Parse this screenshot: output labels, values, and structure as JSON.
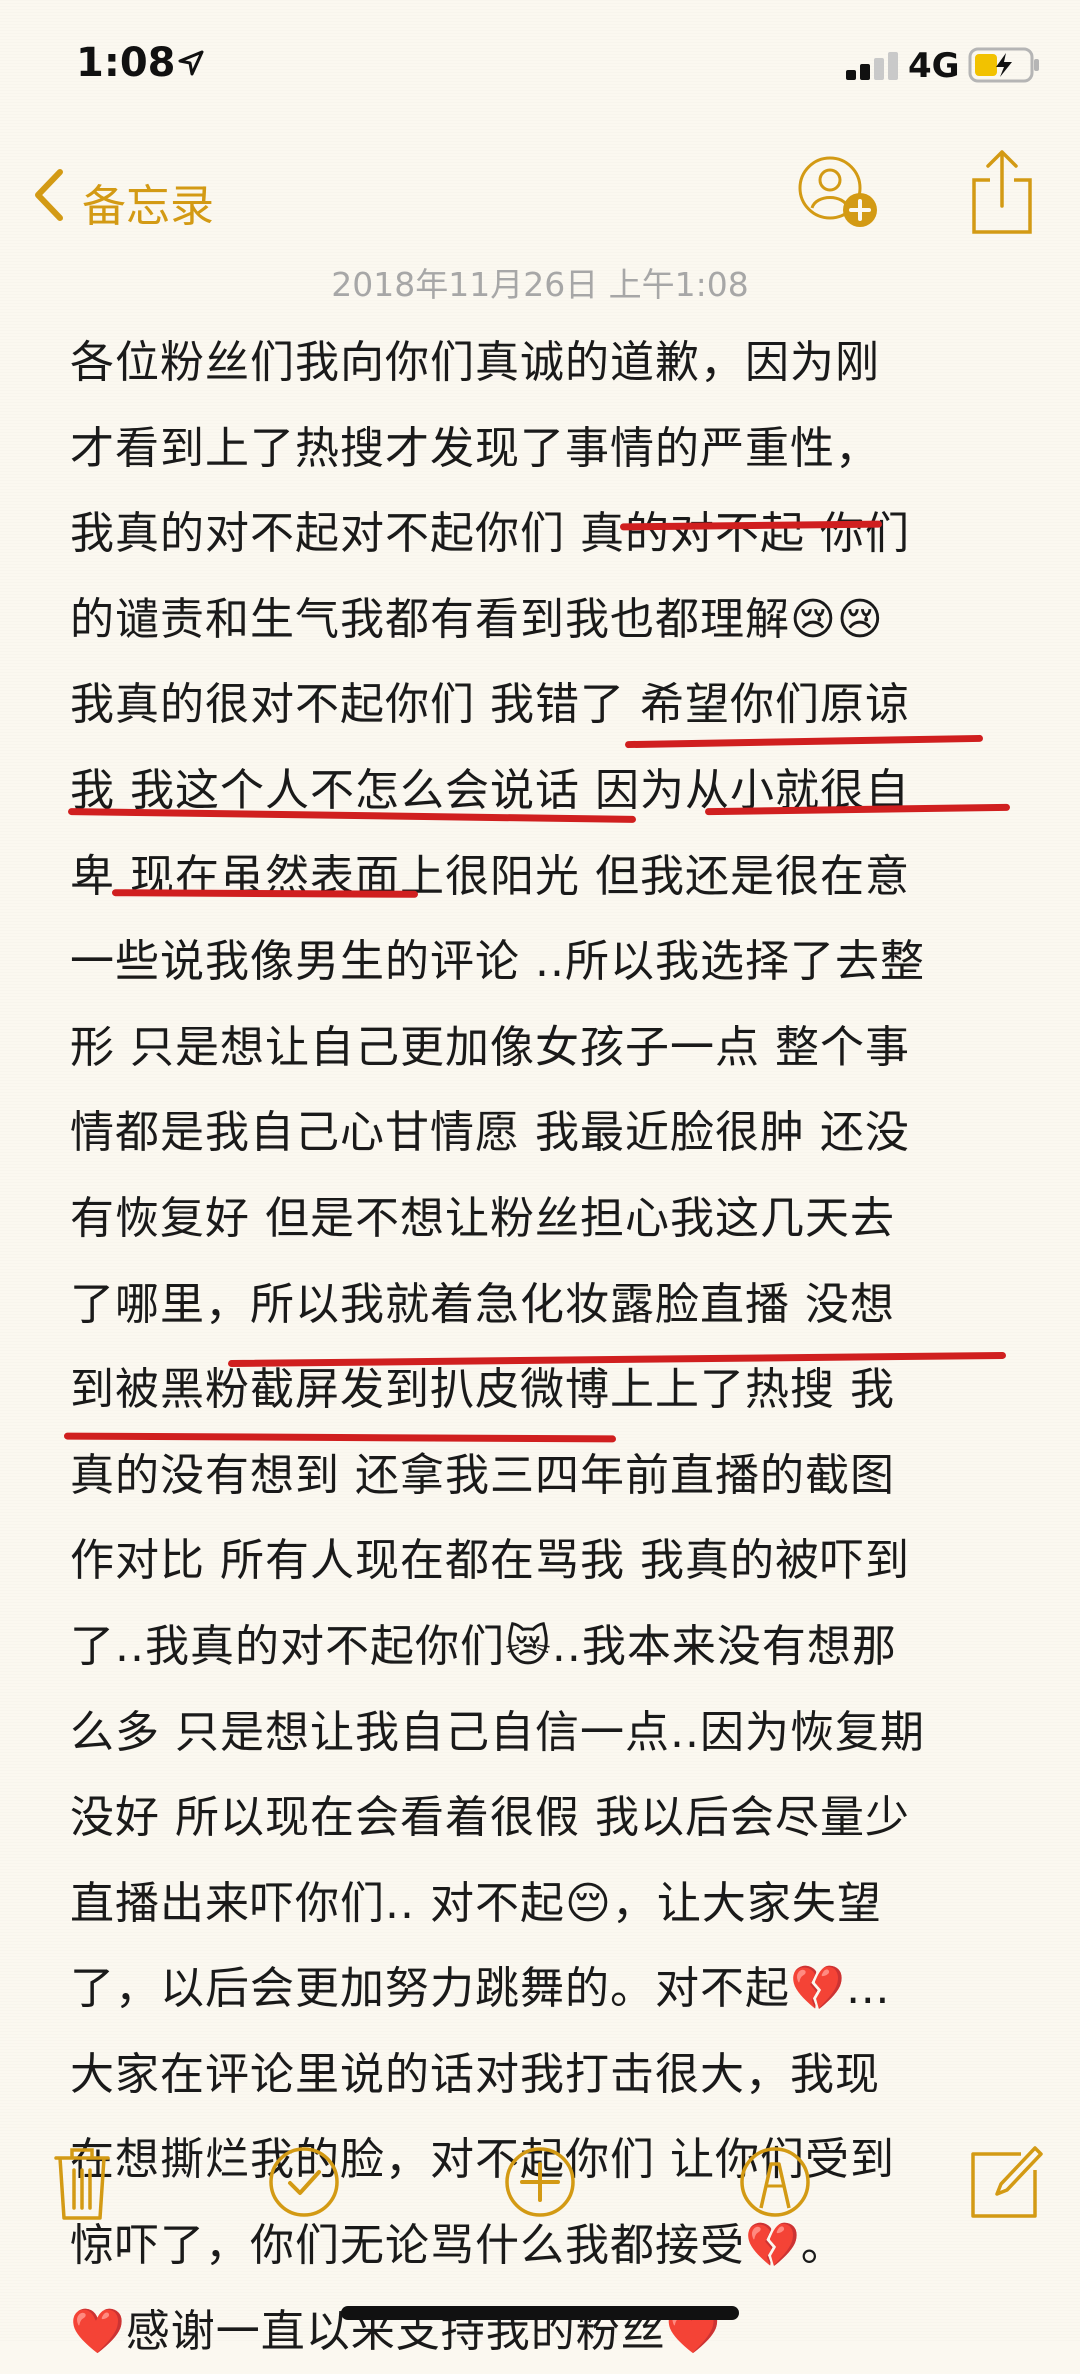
{
  "status_bar": {
    "time": "1:08",
    "network": "4G"
  },
  "nav": {
    "back_label": "备忘录"
  },
  "note": {
    "date": "2018年11月26日 上午1:08",
    "lines": [
      "各位粉丝们我向你们真诚的道歉，因为刚",
      "才看到上了热搜才发现了事情的严重性，",
      "我真的对不起对不起你们 真的对不起 你们",
      "的谴责和生气我都有看到我也都理解😢😢",
      "我真的很对不起你们 我错了 希望你们原谅",
      "我 我这个人不怎么会说话 因为从小就很自",
      "卑 现在虽然表面上很阳光 但我还是很在意",
      "一些说我像男生的评论 ..所以我选择了去整",
      "形 只是想让自己更加像女孩子一点 整个事",
      "情都是我自己心甘情愿 我最近脸很肿 还没",
      "有恢复好 但是不想让粉丝担心我这几天去",
      "了哪里，所以我就着急化妆露脸直播 没想",
      "到被黑粉截屏发到扒皮微博上上了热搜 我",
      "真的没有想到 还拿我三四年前直播的截图",
      "作对比 所有人现在都在骂我 我真的被吓到",
      "了..我真的对不起你们😿..我本来没有想那",
      "么多 只是想让我自己自信一点..因为恢复期",
      "没好 所以现在会看着很假  我以后会尽量少",
      "直播出来吓你们.. 对不起😔，让大家失望",
      "了，以后会更加努力跳舞的。对不起💔…",
      "大家在评论里说的话对我打击很大，我现",
      "在想撕烂我的脸，对不起你们 让你们受到",
      "惊吓了，你们无论骂什么我都接受💔。",
      "❤️感谢一直以来支持我的粉丝❤️"
    ]
  },
  "colors": {
    "accent": "#d39a14",
    "underline": "#d01f1f",
    "background": "#fbf8f0",
    "date_text": "#a7a7a7"
  },
  "icons": {
    "status": [
      "location-arrow-icon",
      "signal-icon",
      "battery-charging-icon"
    ],
    "nav": [
      "chevron-left-icon",
      "add-person-icon",
      "share-icon"
    ],
    "toolbar": [
      "trash-icon",
      "checklist-icon",
      "plus-circle-icon",
      "markup-pen-icon",
      "compose-icon"
    ]
  }
}
